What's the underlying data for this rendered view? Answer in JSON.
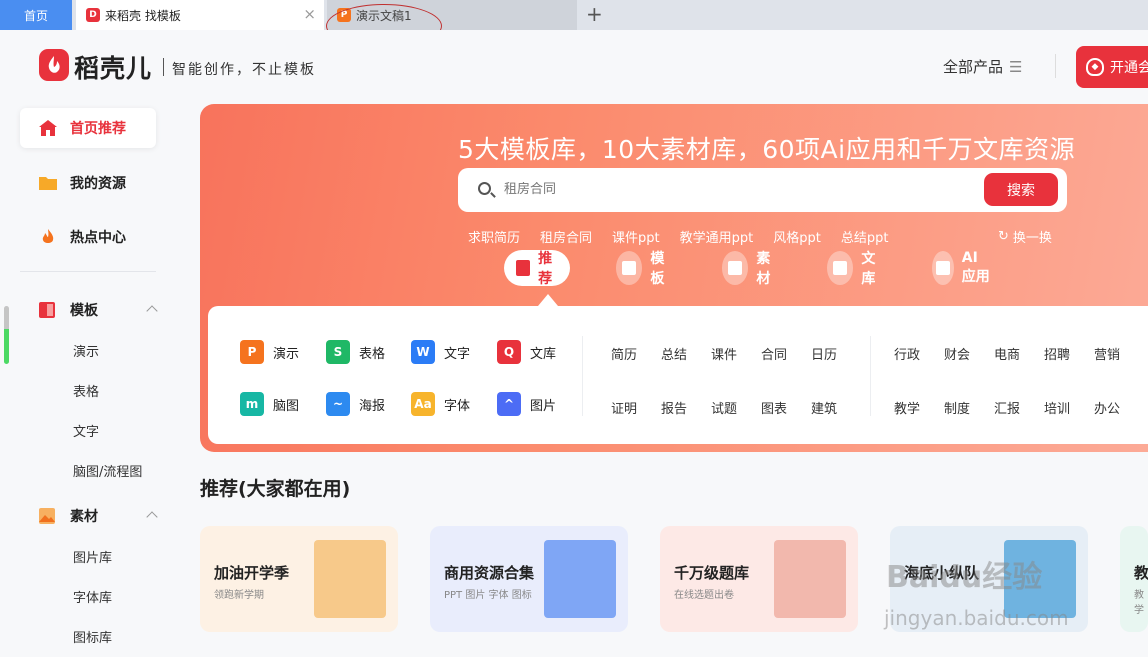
{
  "tabs": {
    "home": "首页",
    "active": "来稻壳 找模板",
    "doc": "演示文稿1",
    "add": "+",
    "close": "×"
  },
  "header": {
    "brand": "稻壳儿",
    "slogan": "智能创作，不止模板",
    "all_products": "全部产品",
    "vip_button": "开通会"
  },
  "sidebar": {
    "main": [
      {
        "label": "首页推荐",
        "icon": "home-icon"
      },
      {
        "label": "我的资源",
        "icon": "folder-icon"
      },
      {
        "label": "热点中心",
        "icon": "fire-icon"
      }
    ],
    "template_section": "模板",
    "template_items": [
      "演示",
      "表格",
      "文字",
      "脑图/流程图"
    ],
    "material_section": "素材",
    "material_items": [
      "图片库",
      "字体库",
      "图标库"
    ]
  },
  "banner": {
    "title": "5大模板库，10大素材库，60项Ai应用和千万文库资源",
    "search_placeholder": "租房合同",
    "search_button": "搜索",
    "hot_tags": [
      "求职简历",
      "租房合同",
      "课件ppt",
      "教学通用ppt",
      "风格ppt",
      "总结ppt"
    ],
    "refresh": "换一换",
    "categories": [
      "推荐",
      "模板",
      "素材",
      "文库",
      "AI应用"
    ]
  },
  "panel": {
    "apps": [
      {
        "label": "演示",
        "glyph": "P",
        "color": "#f5731e"
      },
      {
        "label": "表格",
        "glyph": "S",
        "color": "#1fb866"
      },
      {
        "label": "文字",
        "glyph": "W",
        "color": "#2b7cf6"
      },
      {
        "label": "文库",
        "glyph": "Q",
        "color": "#e8323c"
      },
      {
        "label": "脑图",
        "glyph": "m",
        "color": "#17b7a4"
      },
      {
        "label": "海报",
        "glyph": "~",
        "color": "#2d8af0"
      },
      {
        "label": "字体",
        "glyph": "Aa",
        "color": "#f7b42c"
      },
      {
        "label": "图片",
        "glyph": "^",
        "color": "#4c6cf5"
      }
    ],
    "keywords_row1": [
      "简历",
      "总结",
      "课件",
      "合同",
      "日历"
    ],
    "keywords_row2": [
      "证明",
      "报告",
      "试题",
      "图表",
      "建筑"
    ],
    "keywords_row3": [
      "行政",
      "财会",
      "电商",
      "招聘",
      "营销"
    ],
    "keywords_row4": [
      "教学",
      "制度",
      "汇报",
      "培训",
      "办公"
    ]
  },
  "recommend": {
    "title": "推荐(大家都在用)",
    "cards": [
      {
        "title": "加油开学季",
        "sub": "领跑新学期",
        "bg": "#fdf1e4",
        "art": "#f7c98a"
      },
      {
        "title": "商用资源合集",
        "sub": "PPT 图片 字体 图标",
        "bg": "#e9edfc",
        "art": "#7fa6f5"
      },
      {
        "title": "千万级题库",
        "sub": "在线选题出卷",
        "bg": "#fde9e6",
        "art": "#f2b8ad"
      },
      {
        "title": "海底小纵队",
        "sub": "",
        "bg": "#e6eef6",
        "art": "#6fb3e0"
      },
      {
        "title": "教",
        "sub": "教学",
        "bg": "#e8f6f1",
        "art": "#9dd9c4"
      }
    ]
  },
  "watermark": {
    "line1": "Baidu经验",
    "line2": "jingyan.baidu.com"
  }
}
